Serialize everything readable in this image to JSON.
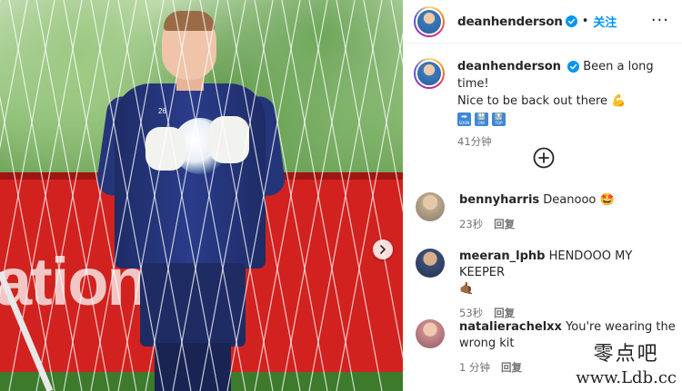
{
  "post": {
    "username": "deanhenderson",
    "dot": "•",
    "follow_label": "关注",
    "more_label": "···",
    "caption": {
      "username": "deanhenderson",
      "text_line1": "Been a long time!",
      "text_line2": "Nice to be back out there",
      "flex_emoji": "💪",
      "emoji_boxes": [
        {
          "arrow": "➡",
          "label": "SOON"
        },
        {
          "arrow": "🔛",
          "label": "ON!"
        },
        {
          "arrow": "🔝",
          "label": "TOP"
        }
      ],
      "time": "41分钟"
    }
  },
  "photo": {
    "shirt_number": "26",
    "hoarding_text": "ation"
  },
  "comments": [
    {
      "username": "bennyharris",
      "text": "Deanooo",
      "emoji": "🤩",
      "time": "23秒",
      "reply": "回复",
      "avatar_color": "#b9a78e"
    },
    {
      "username": "meeran_lphb",
      "text": "HENDOOO MY KEEPER",
      "emoji": "🤙🏾",
      "time": "53秒",
      "reply": "回复",
      "avatar_color": "#3c4d74"
    },
    {
      "username": "natalierachelxx",
      "text": "You're wearing the",
      "text2": "wrong kit",
      "time": "1 分钟",
      "reply": "回复",
      "avatar_color": "#c98a8f"
    }
  ],
  "watermark": {
    "cn": "零点吧",
    "url": "www.Ldb.cc"
  },
  "colors": {
    "accent": "#0095f6",
    "verified": "#0095f6",
    "muted_text": "#737373"
  }
}
